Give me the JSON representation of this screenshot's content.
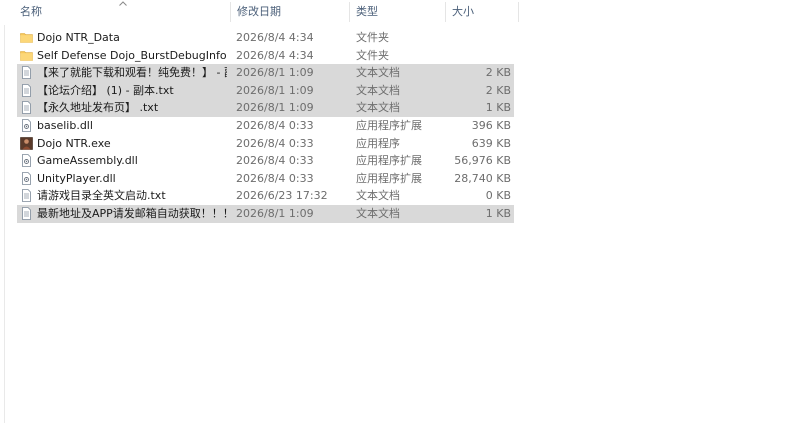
{
  "columns": {
    "name": "名称",
    "modified": "修改日期",
    "type": "类型",
    "size": "大小"
  },
  "files": [
    {
      "name": "Dojo NTR_Data",
      "modified": "2026/8/4 4:34",
      "type": "文件夹",
      "size": "",
      "icon": "folder-icon",
      "selected": false
    },
    {
      "name": "Self Defense Dojo_BurstDebugInform...",
      "modified": "2026/8/4 4:34",
      "type": "文件夹",
      "size": "",
      "icon": "folder-icon",
      "selected": false
    },
    {
      "name": "【来了就能下载和观看！纯免费！】 - 副...",
      "modified": "2026/8/1 1:09",
      "type": "文本文档",
      "size": "2 KB",
      "icon": "text-file-icon",
      "selected": true
    },
    {
      "name": "【论坛介绍】 (1) - 副本.txt",
      "modified": "2026/8/1 1:09",
      "type": "文本文档",
      "size": "2 KB",
      "icon": "text-file-icon",
      "selected": true
    },
    {
      "name": "【永久地址发布页】 .txt",
      "modified": "2026/8/1 1:09",
      "type": "文本文档",
      "size": "1 KB",
      "icon": "text-file-icon",
      "selected": true
    },
    {
      "name": "baselib.dll",
      "modified": "2026/8/4 0:33",
      "type": "应用程序扩展",
      "size": "396 KB",
      "icon": "dll-file-icon",
      "selected": false
    },
    {
      "name": "Dojo NTR.exe",
      "modified": "2026/8/4 0:33",
      "type": "应用程序",
      "size": "639 KB",
      "icon": "exe-app-icon",
      "selected": false
    },
    {
      "name": "GameAssembly.dll",
      "modified": "2026/8/4 0:33",
      "type": "应用程序扩展",
      "size": "56,976 KB",
      "icon": "dll-file-icon",
      "selected": false
    },
    {
      "name": "UnityPlayer.dll",
      "modified": "2026/8/4 0:33",
      "type": "应用程序扩展",
      "size": "28,740 KB",
      "icon": "dll-file-icon",
      "selected": false
    },
    {
      "name": "请游戏目录全英文启动.txt",
      "modified": "2026/6/23 17:32",
      "type": "文本文档",
      "size": "0 KB",
      "icon": "text-file-icon",
      "selected": false
    },
    {
      "name": "最新地址及APP请发邮箱自动获取！！！...",
      "modified": "2026/8/1 1:09",
      "type": "文本文档",
      "size": "1 KB",
      "icon": "text-file-icon",
      "selected": true
    }
  ],
  "colors": {
    "header_text": "#4c607a",
    "selection": "#d9d9d9",
    "folder": "#f7c85a",
    "meta_text": "#6d6d6d"
  }
}
